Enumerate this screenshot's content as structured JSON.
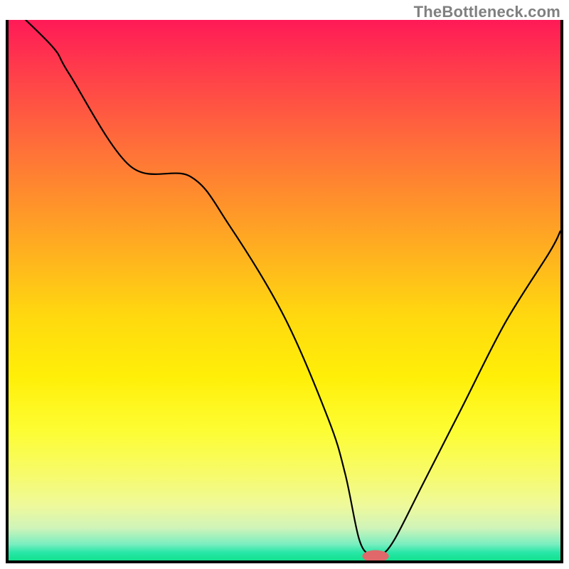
{
  "attribution": "TheBottleneck.com",
  "chart_data": {
    "type": "line",
    "title": "",
    "xlabel": "",
    "ylabel": "",
    "xlim": [
      0,
      100
    ],
    "ylim": [
      0,
      100
    ],
    "series": [
      {
        "name": "bottleneck-curve",
        "x": [
          0,
          8,
          11,
          22,
          33,
          40,
          50,
          58,
          61,
          63.5,
          65.5,
          67.5,
          70,
          75,
          82,
          90,
          98,
          100
        ],
        "values": [
          103,
          95,
          90,
          73,
          71,
          62,
          45,
          26,
          16,
          4,
          1,
          1,
          4,
          14,
          28,
          44,
          57,
          61
        ]
      }
    ],
    "minimum_marker": {
      "x": 66.5,
      "y": 0.8,
      "rx": 2.4,
      "ry": 1.1
    },
    "background_gradient_stops": [
      {
        "pos": 0,
        "color": "#ff1a57"
      },
      {
        "pos": 0.1,
        "color": "#ff3f4a"
      },
      {
        "pos": 0.22,
        "color": "#ff6a3b"
      },
      {
        "pos": 0.33,
        "color": "#ff8f2c"
      },
      {
        "pos": 0.44,
        "color": "#ffb41e"
      },
      {
        "pos": 0.55,
        "color": "#ffd90f"
      },
      {
        "pos": 0.66,
        "color": "#ffef08"
      },
      {
        "pos": 0.76,
        "color": "#fdfd33"
      },
      {
        "pos": 0.84,
        "color": "#f7fb6a"
      },
      {
        "pos": 0.9,
        "color": "#eef99c"
      },
      {
        "pos": 0.94,
        "color": "#cff4b9"
      },
      {
        "pos": 0.97,
        "color": "#79eec0"
      },
      {
        "pos": 0.985,
        "color": "#28e7a8"
      },
      {
        "pos": 1.0,
        "color": "#12e18e"
      }
    ],
    "marker_color": "#e0686a"
  }
}
